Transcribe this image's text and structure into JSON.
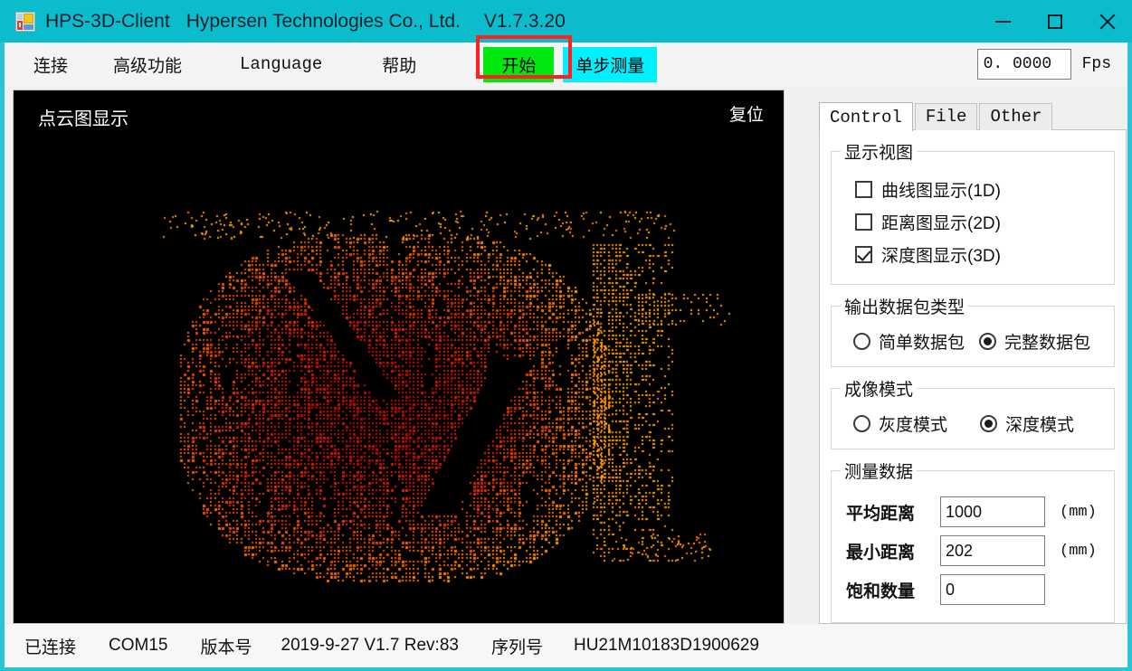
{
  "window": {
    "icon": "app-window-icon",
    "title": "HPS-3D-Client",
    "company": "Hypersen Technologies Co., Ltd.",
    "version": "V1.7.3.20",
    "titlebar_color": "#0bbccd",
    "controls": {
      "minimize": "minimize-icon",
      "maximize": "maximize-icon",
      "close": "close-icon"
    }
  },
  "menubar": {
    "items": [
      {
        "label": "连接"
      },
      {
        "label": "高级功能"
      },
      {
        "label": "Language"
      },
      {
        "label": "帮助"
      }
    ],
    "start_button": {
      "label": "开始",
      "color": "#00e810",
      "highlight_color": "#ff2020"
    },
    "step_button": {
      "label": "单步测量",
      "color": "#00f0ff"
    },
    "fps": {
      "value": "0. 0000",
      "label": "Fps"
    }
  },
  "canvas": {
    "title": "点云图显示",
    "reset_label": "复位",
    "background": "#000000",
    "point_colors": [
      "#ffb000",
      "#ff8c00",
      "#ee5500",
      "#d62200",
      "#bb0d00"
    ]
  },
  "panel": {
    "tabs": [
      {
        "label": "Control",
        "active": true
      },
      {
        "label": "File",
        "active": false
      },
      {
        "label": "Other",
        "active": false
      }
    ],
    "display_view": {
      "legend": "显示视图",
      "checkboxes": [
        {
          "label": "曲线图显示(1D)",
          "checked": false
        },
        {
          "label": "距离图显示(2D)",
          "checked": false
        },
        {
          "label": "深度图显示(3D)",
          "checked": true
        }
      ]
    },
    "packet_type": {
      "legend": "输出数据包类型",
      "options": [
        {
          "label": "简单数据包",
          "selected": false
        },
        {
          "label": "完整数据包",
          "selected": true
        }
      ]
    },
    "imaging_mode": {
      "legend": "成像模式",
      "options": [
        {
          "label": "灰度模式",
          "selected": false
        },
        {
          "label": "深度模式",
          "selected": true
        }
      ]
    },
    "measure_data": {
      "legend": "测量数据",
      "rows": [
        {
          "label": "平均距离",
          "value": "1000",
          "unit": "(mm)"
        },
        {
          "label": "最小距离",
          "value": "202",
          "unit": "(mm)"
        },
        {
          "label": "饱和数量",
          "value": "0",
          "unit": ""
        }
      ]
    }
  },
  "statusbar": {
    "connection": "已连接",
    "port": "COM15",
    "version_label": "版本号",
    "version_value": "2019-9-27 V1.7 Rev:83",
    "serial_label": "序列号",
    "serial_value": "HU21M10183D1900629"
  }
}
